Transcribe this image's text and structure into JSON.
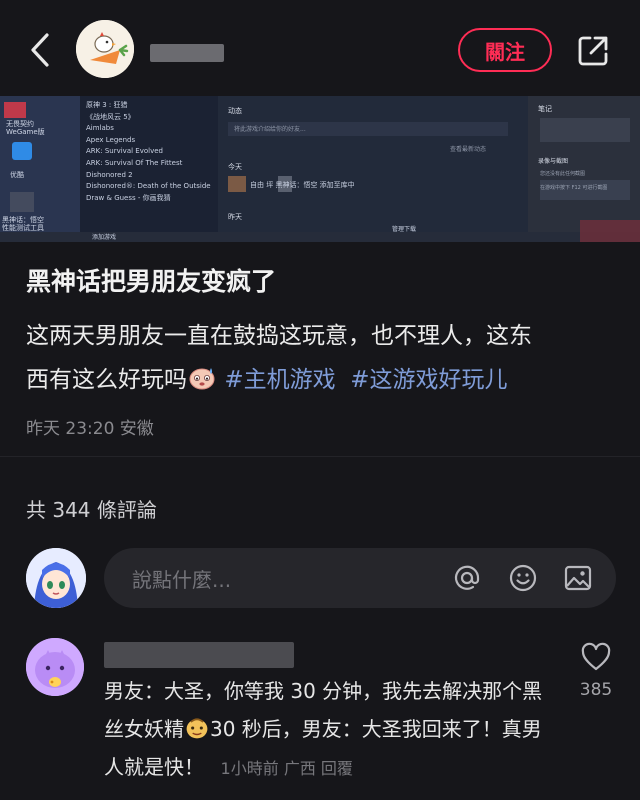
{
  "header": {
    "follow_label": "關注"
  },
  "photo": {
    "left_icons": [
      "无畏契约 WeGame版",
      "优酷",
      "黑神话：悟空 性能测试工具"
    ],
    "games": [
      "原神 3 : 狂猎",
      "《战地风云 5》",
      "Aimlabs",
      "Apex Legends",
      "ARK: Survival Evolved",
      "ARK: Survival Of The Fittest",
      "Dishonored 2",
      "Dishonored®: Death of the Outside",
      "Draw & Guess - 你画我猜"
    ],
    "add_game": "添加游戏",
    "activity_label": "动态",
    "activity_input": "将此游戏介绍给你的好友...",
    "view_all": "查看最新动态",
    "today": "今天",
    "friend_entry": "自由 坪   黑神话：悟空 添加至库中",
    "yesterday": "昨天",
    "manage_download": "管理下载",
    "notes_label": "笔记",
    "screenshot_label": "录像与截图",
    "screenshot_hint1": "您还没有此任何截图",
    "screenshot_hint2": "在游戏中按下 F12 可进行截图"
  },
  "post": {
    "title": "黑神话把男朋友变疯了",
    "body_line1": "这两天男朋友一直在鼓捣这玩意，也不理人，这东",
    "body_line2": "西有这么好玩吗",
    "hashtag1": "#主机游戏",
    "hashtag2": "#这游戏好玩儿",
    "meta": "昨天 23:20 安徽"
  },
  "comments": {
    "count_label": "共 344 條評論",
    "input_placeholder": "說點什麼..."
  },
  "comment1": {
    "text_part1": "男友：大圣，你等我 30 分钟，我先去解决那个黑丝女妖精",
    "text_part2": "30 秒后，男友：大圣我回来了！真男人就是快！",
    "time": "1小時前",
    "location": "广西",
    "reply_label": "回覆",
    "like_count": "385"
  },
  "colors": {
    "background": "#16161a",
    "accent": "#ff2d55",
    "hashtag": "#7f9cd8",
    "input_bg": "#26262b"
  }
}
